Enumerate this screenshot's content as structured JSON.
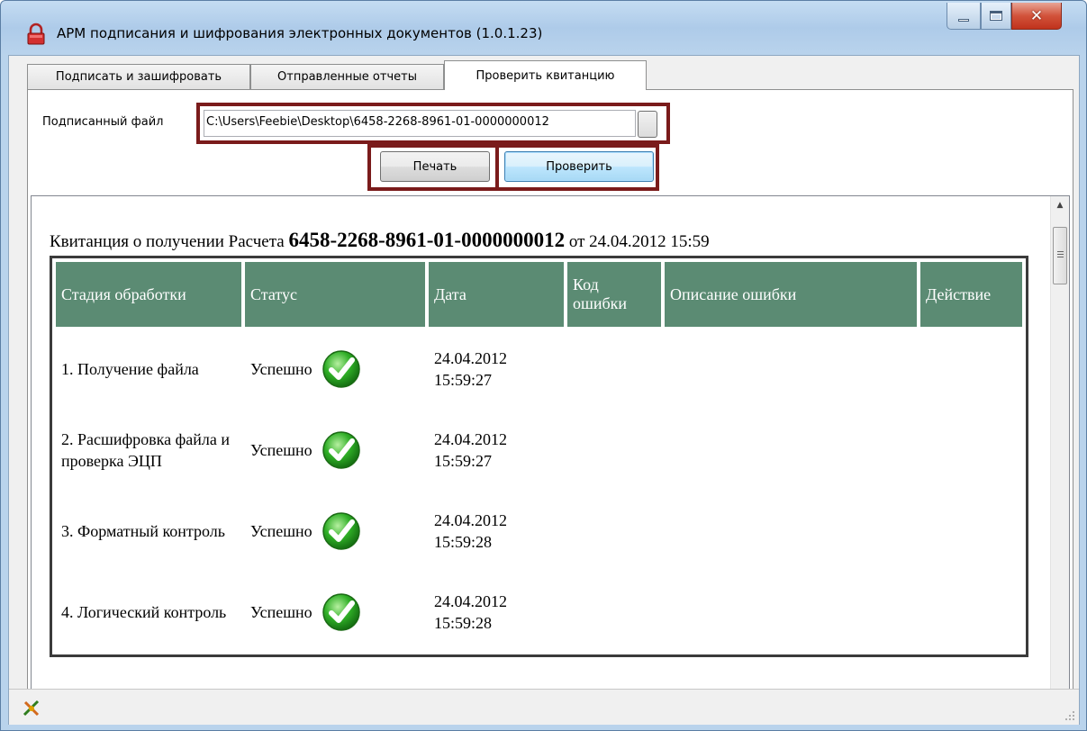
{
  "window": {
    "title": "АРМ подписания и шифрования электронных документов (1.0.1.23)",
    "controls": {
      "minimize": "minimize-icon",
      "maximize": "maximize-icon",
      "close": "✕"
    }
  },
  "tabs": [
    {
      "label": "Подписать и зашифровать",
      "selected": false
    },
    {
      "label": "Отправленные отчеты",
      "selected": false
    },
    {
      "label": "Проверить квитанцию",
      "selected": true
    }
  ],
  "form": {
    "file_label": "Подписанный файл",
    "file_value": "C:\\Users\\Feebie\\Desktop\\6458-2268-8961-01-0000000012",
    "print_label": "Печать",
    "check_label": "Проверить"
  },
  "receipt": {
    "title_prefix": "Квитанция о получении Расчета",
    "number": "6458-2268-8961-01-0000000012",
    "title_mid": "от",
    "datetime": "24.04.2012 15:59",
    "columns": [
      "Стадия обработки",
      "Статус",
      "Дата",
      "Код ошибки",
      "Описание ошибки",
      "Действие"
    ],
    "rows": [
      {
        "stage": "1. Получение файла",
        "status": "Успешно",
        "date": "24.04.2012",
        "time": "15:59:27",
        "code": "",
        "description": "",
        "action": ""
      },
      {
        "stage": "2. Расшифровка файла и проверка ЭЦП",
        "status": "Успешно",
        "date": "24.04.2012",
        "time": "15:59:27",
        "code": "",
        "description": "",
        "action": ""
      },
      {
        "stage": "3. Форматный контроль",
        "status": "Успешно",
        "date": "24.04.2012",
        "time": "15:59:28",
        "code": "",
        "description": "",
        "action": ""
      },
      {
        "stage": "4. Логический контроль",
        "status": "Успешно",
        "date": "24.04.2012",
        "time": "15:59:28",
        "code": "",
        "description": "",
        "action": ""
      }
    ]
  },
  "colors": {
    "table_header": "#5b8b73",
    "highlight_border": "#7a1b1b",
    "ok_green": "#2fae26"
  }
}
